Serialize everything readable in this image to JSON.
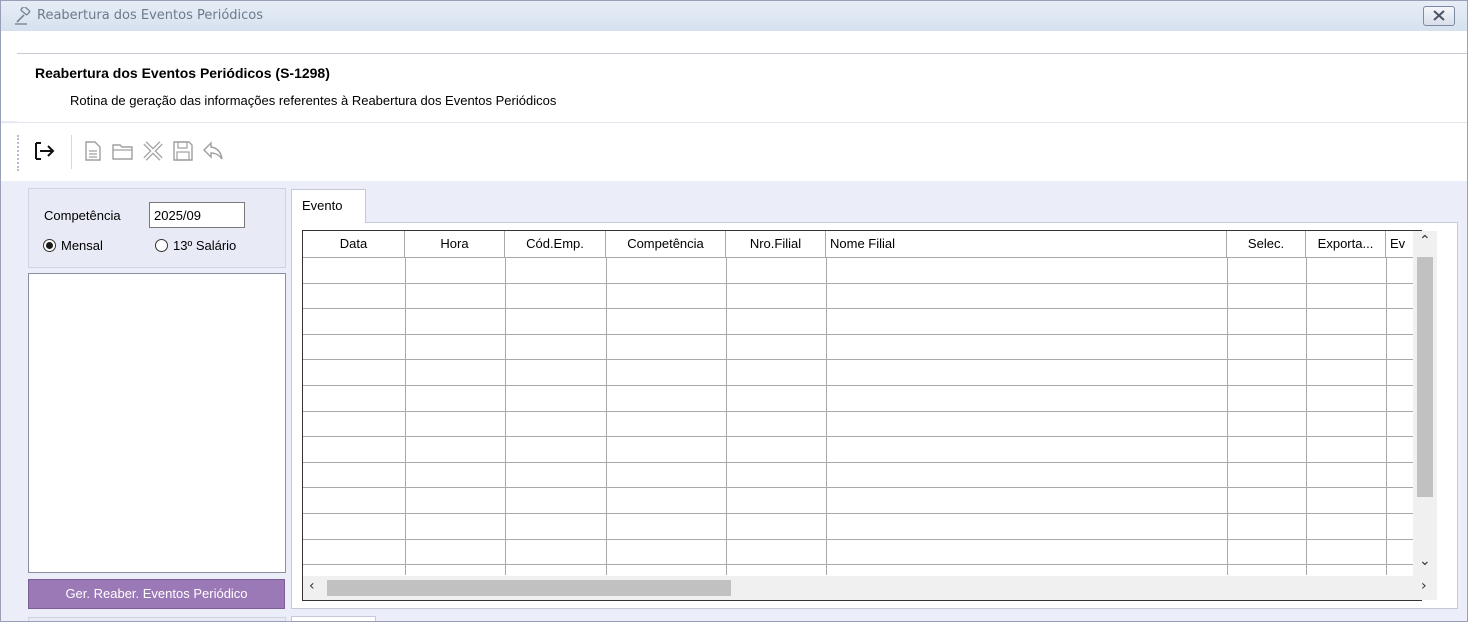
{
  "window": {
    "title": "Reabertura dos Eventos Periódicos",
    "close_icon": "close-icon"
  },
  "header": {
    "title": "Reabertura dos Eventos Periódicos (S-1298)",
    "subtitle": "Rotina de geração das informações referentes à Reabertura dos Eventos Periódicos"
  },
  "toolbar": {
    "items": [
      "exit-icon",
      "new-document-icon",
      "open-folder-icon",
      "delete-icon",
      "save-icon",
      "undo-icon"
    ]
  },
  "filters": {
    "competencia_label": "Competência",
    "competencia_value": "2025/09",
    "radio_mensal": "Mensal",
    "radio_13": "13º Salário",
    "selected": "Mensal"
  },
  "actions": {
    "generate_label": "Ger. Reaber. Eventos Periódico"
  },
  "tabs": {
    "active": "Evento"
  },
  "grid": {
    "columns": [
      "Data",
      "Hora",
      "Cód.Emp.",
      "Competência",
      "Nro.Filial",
      "Nome Filial",
      "Selec.",
      "Exporta...",
      "Ev"
    ],
    "rows": []
  },
  "colors": {
    "accent_button": "#9b78b6",
    "background": "#ebedf8"
  }
}
